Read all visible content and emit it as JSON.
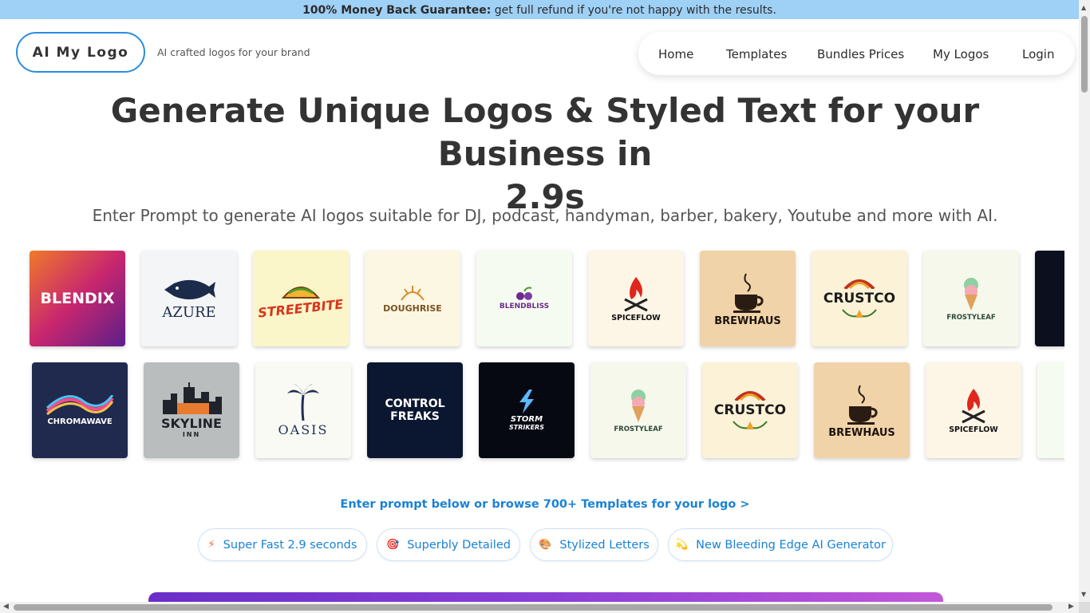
{
  "banner": {
    "bold": "100% Money Back Guarantee:",
    "rest": " get full refund if you're not happy with the results."
  },
  "header": {
    "logo_label": "AI My Logo",
    "tagline": "AI crafted logos for your brand"
  },
  "nav": {
    "items": [
      "Home",
      "Templates",
      "Bundles Prices",
      "My Logos",
      "Login"
    ]
  },
  "hero": {
    "title_line1": "Generate Unique Logos & Styled Text for your Business in",
    "title_line2": "2.9s",
    "subtitle": "Enter Prompt to generate AI logos suitable for DJ, podcast, handyman, barber, bakery, Youtube and more with AI."
  },
  "gallery": {
    "row1": [
      "BLENDIX",
      "AZURE",
      "STREETBITE",
      "DOUGHRISE",
      "BLENDBLISS",
      "SPICEFLOW",
      "BREWHAUS",
      "CRUSTCO",
      "FROSTYLEAF"
    ],
    "row2": [
      "CHROMAWAVE",
      "SKYLINE",
      "INN",
      "OASIS",
      "CONTROL",
      "FREAKS",
      "STORM",
      "STRIKERS",
      "FROSTYLEAF",
      "CRUSTCO",
      "BREWHAUS",
      "SPICEFLOW"
    ]
  },
  "cta": "Enter prompt below or browse 700+ Templates for your logo >",
  "features": [
    {
      "icon": "⚡",
      "label": "Super Fast 2.9 seconds"
    },
    {
      "icon": "🎯",
      "label": "Superbly Detailed"
    },
    {
      "icon": "🎨",
      "label": "Stylized Letters"
    },
    {
      "icon": "💫",
      "label": "New Bleeding Edge AI Generator"
    }
  ],
  "colors": {
    "banner": "#9fd0f5",
    "accent": "#1a82d6",
    "logo_border": "#2a8de0"
  }
}
